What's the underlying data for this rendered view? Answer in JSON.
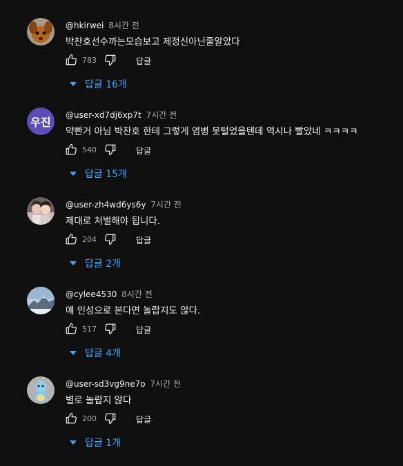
{
  "comments": [
    {
      "handle": "@hkirwei",
      "time": "8시간 전",
      "text": "박찬호선수까는모습보고 제정신아닌줄알았다",
      "likes": "783",
      "reply_label": "답글",
      "replies_label": "답글 16개",
      "avatar": "dog-photo"
    },
    {
      "handle": "@user-xd7dj6xp7t",
      "time": "7시간 전",
      "text": "약빤거 아님 박찬호 한테 그렇게 염병 못털었을텐데 역시나 빨았네 ㅋㅋㅋㅋ",
      "likes": "540",
      "reply_label": "답글",
      "replies_label": "답글 15개",
      "avatar_text": "우진",
      "avatar_color": "#5c4db7"
    },
    {
      "handle": "@user-zh4wd6ys6y",
      "time": "7시간 전",
      "text": "제대로 처벌해야 됩니다.",
      "likes": "204",
      "reply_label": "답글",
      "replies_label": "답글 2개",
      "avatar": "people-photo"
    },
    {
      "handle": "@cylee4530",
      "time": "8시간 전",
      "text": "얘 인성으로 본다면 놀랍지도 않다.",
      "likes": "517",
      "reply_label": "답글",
      "replies_label": "답글 4개",
      "avatar": "mountain-photo"
    },
    {
      "handle": "@user-sd3vg9ne7o",
      "time": "7시간 전",
      "text": "별로 놀랍지 않다",
      "likes": "200",
      "reply_label": "답글",
      "replies_label": "답글 1개",
      "avatar": "figure-photo"
    }
  ]
}
